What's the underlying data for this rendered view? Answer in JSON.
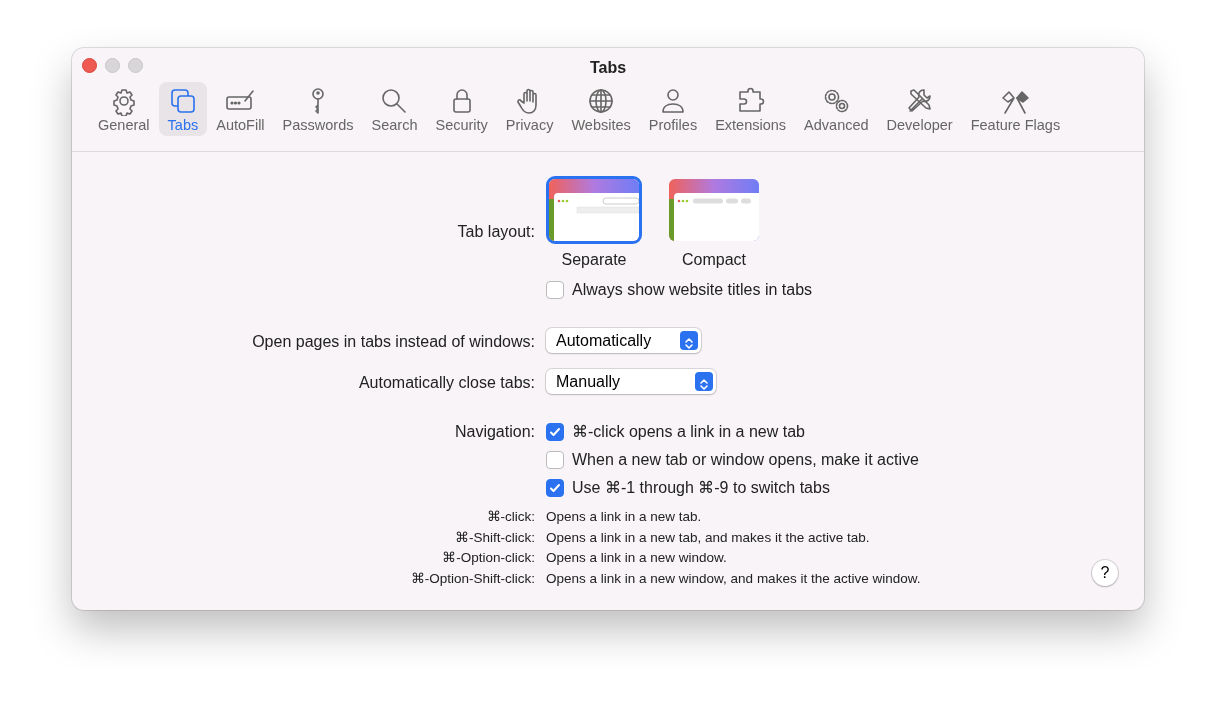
{
  "window": {
    "title": "Tabs"
  },
  "toolbar": {
    "items": [
      {
        "label": "General",
        "selected": false
      },
      {
        "label": "Tabs",
        "selected": true
      },
      {
        "label": "AutoFill",
        "selected": false
      },
      {
        "label": "Passwords",
        "selected": false
      },
      {
        "label": "Search",
        "selected": false
      },
      {
        "label": "Security",
        "selected": false
      },
      {
        "label": "Privacy",
        "selected": false
      },
      {
        "label": "Websites",
        "selected": false
      },
      {
        "label": "Profiles",
        "selected": false
      },
      {
        "label": "Extensions",
        "selected": false
      },
      {
        "label": "Advanced",
        "selected": false
      },
      {
        "label": "Developer",
        "selected": false
      },
      {
        "label": "Feature Flags",
        "selected": false
      }
    ]
  },
  "tab_layout": {
    "label": "Tab layout:",
    "options": [
      {
        "label": "Separate",
        "kind": "separate",
        "selected": true
      },
      {
        "label": "Compact",
        "kind": "compact",
        "selected": false
      }
    ],
    "checkbox": {
      "label": "Always show website titles in tabs",
      "checked": false
    }
  },
  "open_pages": {
    "label": "Open pages in tabs instead of windows:",
    "value": "Automatically"
  },
  "close_tabs": {
    "label": "Automatically close tabs:",
    "value": "Manually"
  },
  "navigation": {
    "label": "Navigation:",
    "options": [
      {
        "label": "⌘-click opens a link in a new tab",
        "checked": true
      },
      {
        "label": "When a new tab or window opens, make it active",
        "checked": false
      },
      {
        "label": "Use ⌘-1 through ⌘-9 to switch tabs",
        "checked": true
      }
    ]
  },
  "shortcuts": [
    {
      "key": "⌘-click:",
      "description": "Opens a link in a new tab."
    },
    {
      "key": "⌘-Shift-click:",
      "description": "Opens a link in a new tab, and makes it the active tab."
    },
    {
      "key": "⌘-Option-click:",
      "description": "Opens a link in a new window."
    },
    {
      "key": "⌘-Option-Shift-click:",
      "description": "Opens a link in a new window, and makes it the active window."
    }
  ],
  "help_button": {
    "label": "?"
  }
}
